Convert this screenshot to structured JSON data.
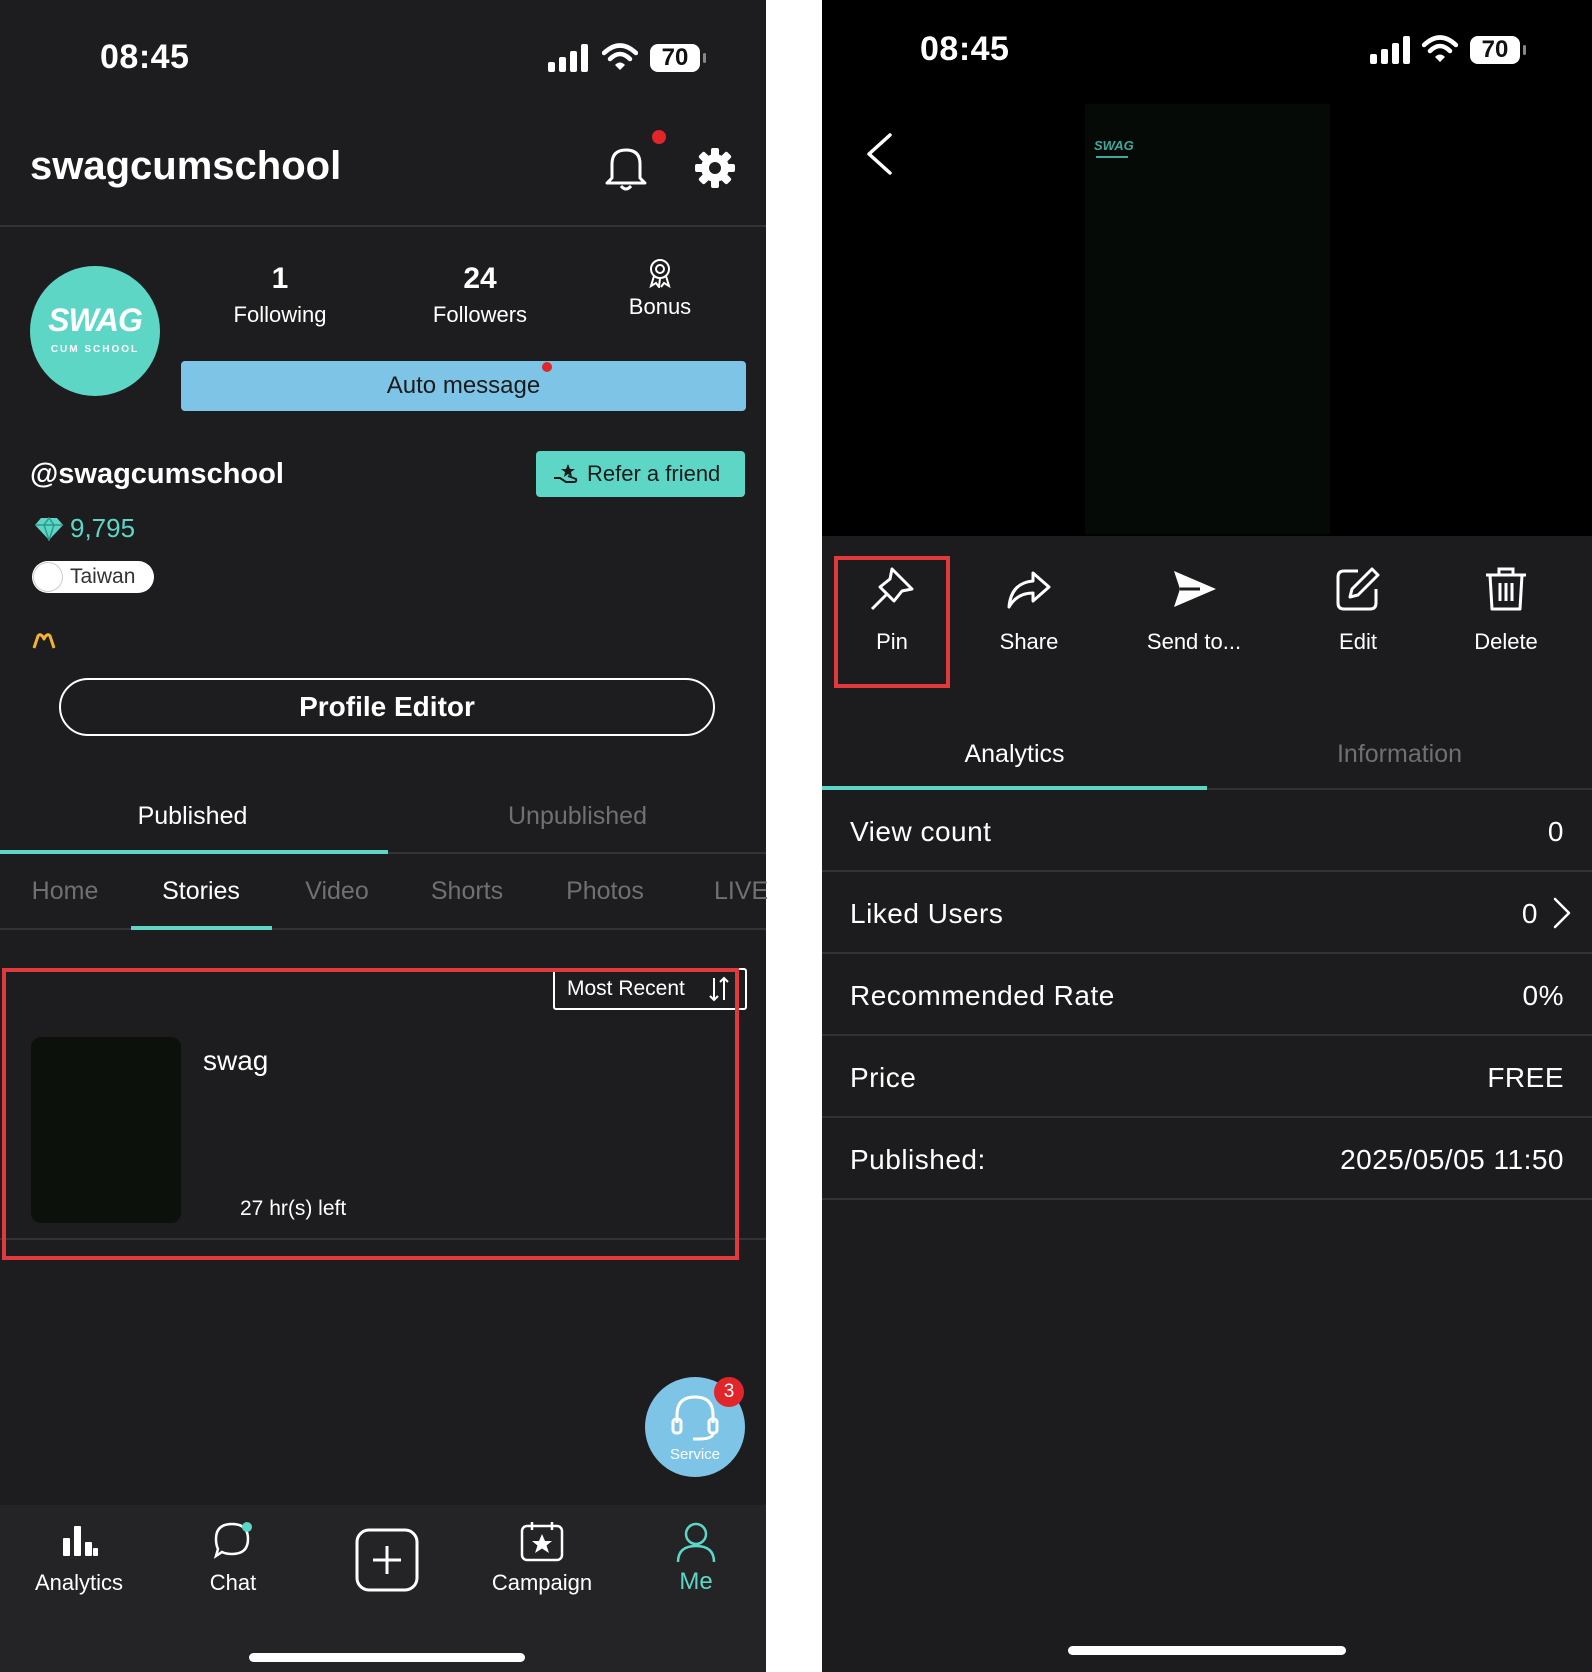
{
  "left": {
    "status": {
      "time": "08:45",
      "battery": "70"
    },
    "header": {
      "username": "swagcumschool"
    },
    "avatar": {
      "line1": "SWAG",
      "line2": "CUM SCHOOL"
    },
    "stats": [
      {
        "value": "1",
        "label": "Following"
      },
      {
        "value": "24",
        "label": "Followers"
      },
      {
        "label": "Bonus"
      }
    ],
    "auto_message_label": "Auto message",
    "handle": "@swagcumschool",
    "refer_label": "Refer a friend",
    "diamonds": "9,795",
    "location": "Taiwan",
    "profile_editor_label": "Profile Editor",
    "tabs": [
      {
        "label": "Published",
        "active": true
      },
      {
        "label": "Unpublished",
        "active": false
      }
    ],
    "subtabs": [
      {
        "label": "Home",
        "active": false
      },
      {
        "label": "Stories",
        "active": true
      },
      {
        "label": "Video",
        "active": false
      },
      {
        "label": "Shorts",
        "active": false
      },
      {
        "label": "Photos",
        "active": false
      },
      {
        "label": "LIVE",
        "active": false
      }
    ],
    "sort_label": "Most Recent",
    "story": {
      "title": "swag",
      "time_left": "27 hr(s) left"
    },
    "service": {
      "label": "Service",
      "badge": "3"
    },
    "bottom_nav": [
      {
        "label": "Analytics",
        "icon": "bar-chart-icon"
      },
      {
        "label": "Chat",
        "icon": "chat-bubble-icon"
      },
      {
        "label": "",
        "icon": "plus-square-icon"
      },
      {
        "label": "Campaign",
        "icon": "calendar-star-icon"
      },
      {
        "label": "Me",
        "icon": "person-icon",
        "active": true
      }
    ],
    "colors": {
      "accent": "#5dd6c6",
      "auto_message_bg": "#7ec4e6",
      "highlight": "#e0393e"
    }
  },
  "right": {
    "status": {
      "time": "08:45",
      "battery": "70"
    },
    "actions": [
      {
        "label": "Pin",
        "icon": "pin-icon"
      },
      {
        "label": "Share",
        "icon": "share-arrow-icon"
      },
      {
        "label": "Send to...",
        "icon": "send-icon"
      },
      {
        "label": "Edit",
        "icon": "edit-icon"
      },
      {
        "label": "Delete",
        "icon": "trash-icon"
      }
    ],
    "tabs": [
      {
        "label": "Analytics",
        "active": true
      },
      {
        "label": "Information",
        "active": false
      }
    ],
    "rows": [
      {
        "key": "View count",
        "value": "0"
      },
      {
        "key": "Liked Users",
        "value": "0"
      },
      {
        "key": "Recommended Rate",
        "value": "0%"
      },
      {
        "key": "Price",
        "value": "FREE"
      },
      {
        "key": "Published:",
        "value": "2025/05/05 11:50"
      }
    ]
  }
}
